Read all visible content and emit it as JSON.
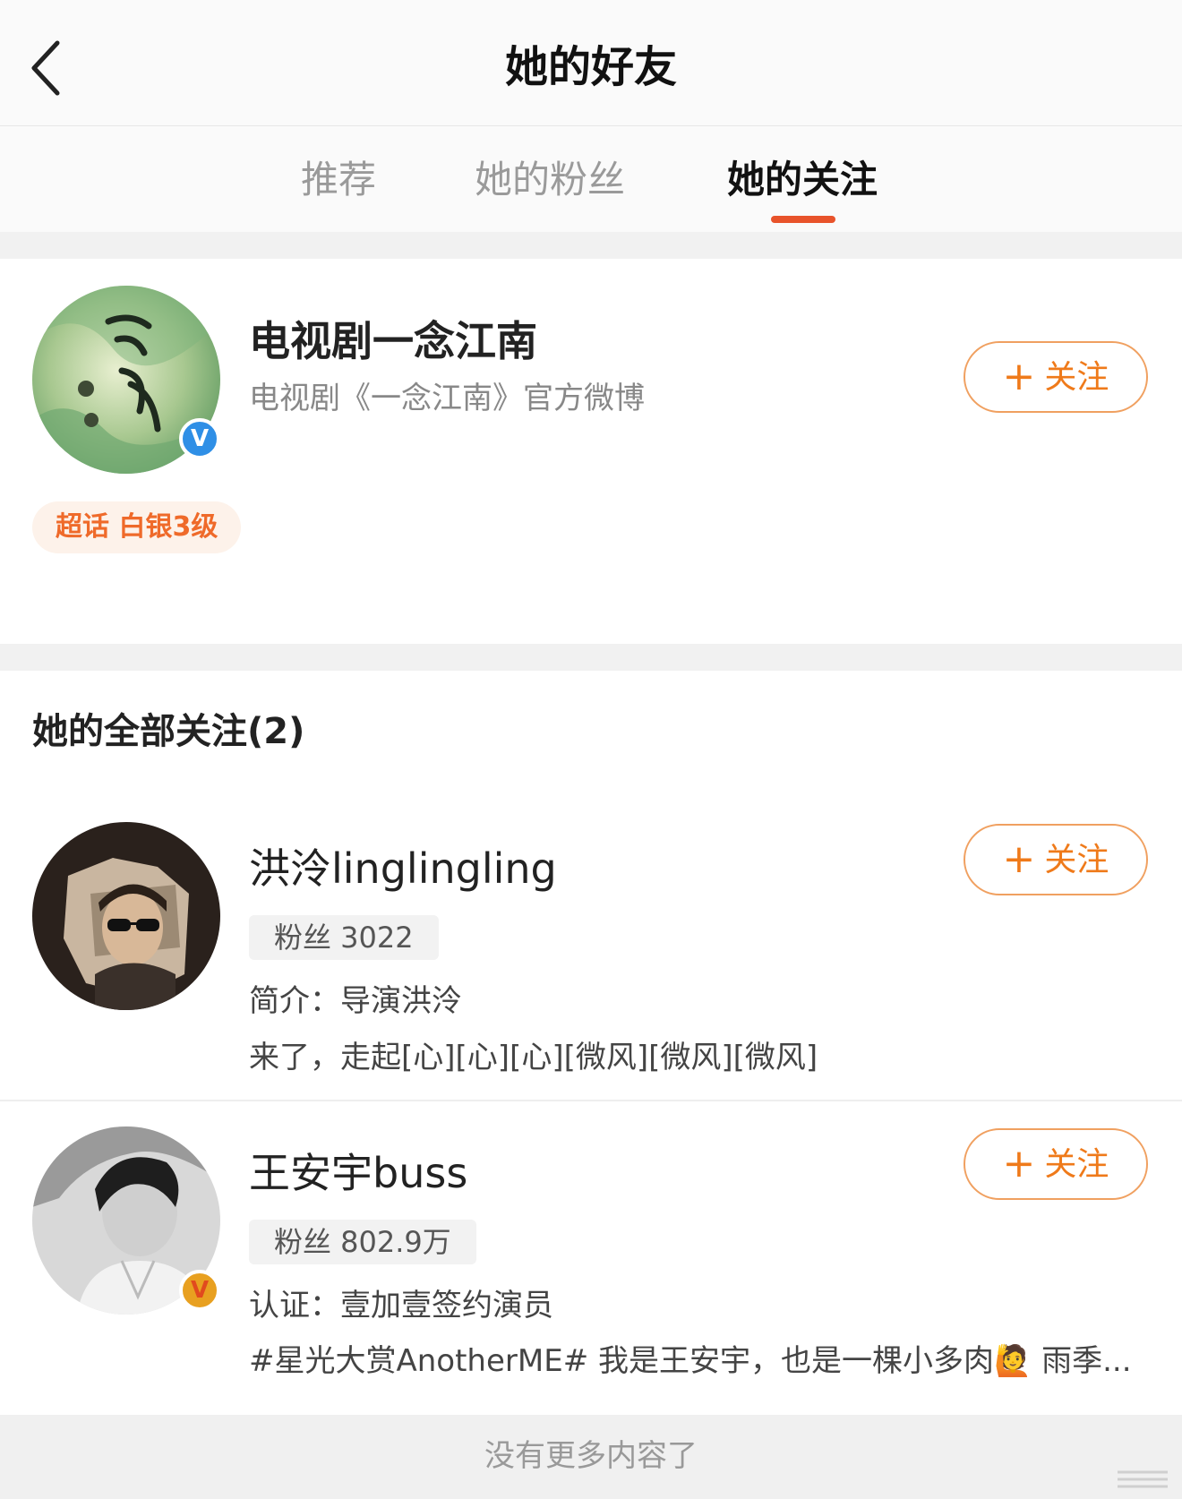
{
  "header": {
    "title": "她的好友"
  },
  "tabs": [
    {
      "label": "推荐"
    },
    {
      "label": "她的粉丝"
    },
    {
      "label": "她的关注"
    }
  ],
  "featured": {
    "name": "电视剧一念江南",
    "description": "电视剧《一念江南》官方微博",
    "chip": "超话 白银3级",
    "follow_label": "关注",
    "verify_badge": "V"
  },
  "section": {
    "title": "她的全部关注(2)"
  },
  "users": [
    {
      "name": "洪泠linglingling",
      "fans": "粉丝 3022",
      "intro": "简介：导演洪泠",
      "latest": "来了，走起[心][心][心][微风][微风][微风]",
      "follow_label": "关注"
    },
    {
      "name": "王安宇buss",
      "fans": "粉丝 802.9万",
      "verify_badge": "V",
      "intro": "认证：壹加壹签约演员",
      "latest": "#星光大赏AnotherME# 我是王安宇，也是一棵小多肉🙋 雨季...",
      "follow_label": "关注"
    }
  ],
  "footer": {
    "text": "没有更多内容了"
  },
  "colors": {
    "accent": "#ef7a1a",
    "tab_underline": "#e8532b",
    "verified_blue": "#2f8fe6",
    "verified_gold": "#e8a020"
  }
}
